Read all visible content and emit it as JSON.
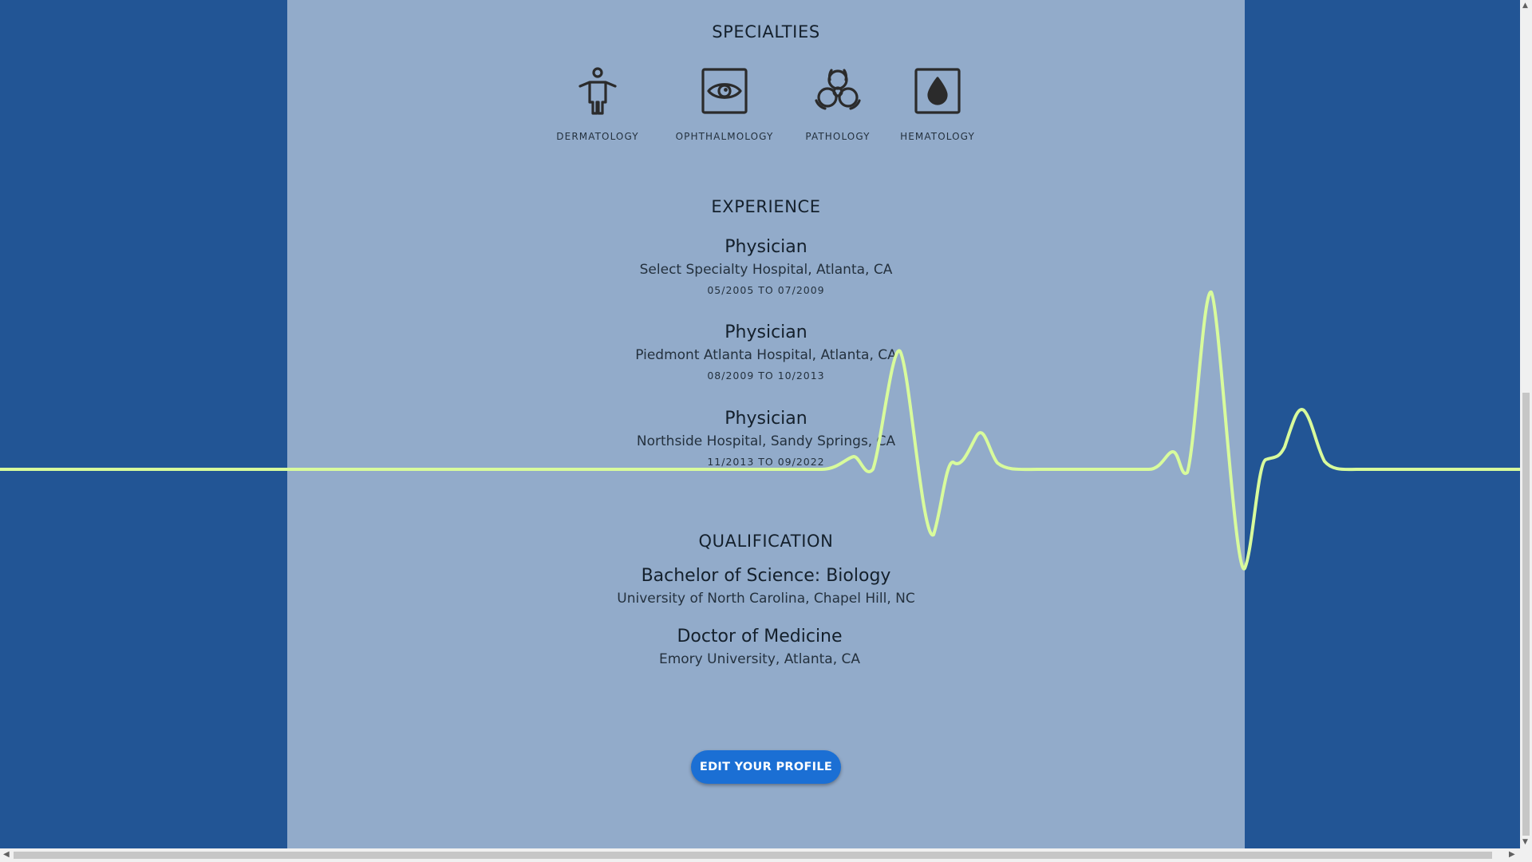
{
  "colors": {
    "page_background": "#225595",
    "panel_background": "#92abca",
    "ekg_line": "#d8fb9c",
    "button_background": "#1b6fd4",
    "button_text": "#ffffff"
  },
  "specialties": {
    "heading": "SPECIALTIES",
    "items": [
      {
        "label": "DERMATOLOGY",
        "icon": "person-accessibility-icon"
      },
      {
        "label": "OPHTHALMOLOGY",
        "icon": "eye-icon"
      },
      {
        "label": "PATHOLOGY",
        "icon": "biohazard-icon"
      },
      {
        "label": "HEMATOLOGY",
        "icon": "blood-drop-icon"
      }
    ]
  },
  "experience": {
    "heading": "EXPERIENCE",
    "jobs": [
      {
        "title": "Physician",
        "place": "Select Specialty Hospital, Atlanta, CA",
        "dates": "05/2005 TO 07/2009"
      },
      {
        "title": "Physician",
        "place": "Piedmont Atlanta Hospital, Atlanta, CA",
        "dates": "08/2009 TO 10/2013"
      },
      {
        "title": "Physician",
        "place": "Northside Hospital, Sandy Springs, CA",
        "dates": "11/2013 TO 09/2022"
      }
    ]
  },
  "qualification": {
    "heading": "QUALIFICATION",
    "degrees": [
      {
        "title": "Bachelor of Science: Biology",
        "place": "University of North Carolina, Chapel Hill, NC"
      },
      {
        "title": "Doctor of Medicine",
        "place": "Emory University, Atlanta, CA"
      }
    ]
  },
  "actions": {
    "edit_profile_label": "EDIT YOUR PROFILE"
  }
}
